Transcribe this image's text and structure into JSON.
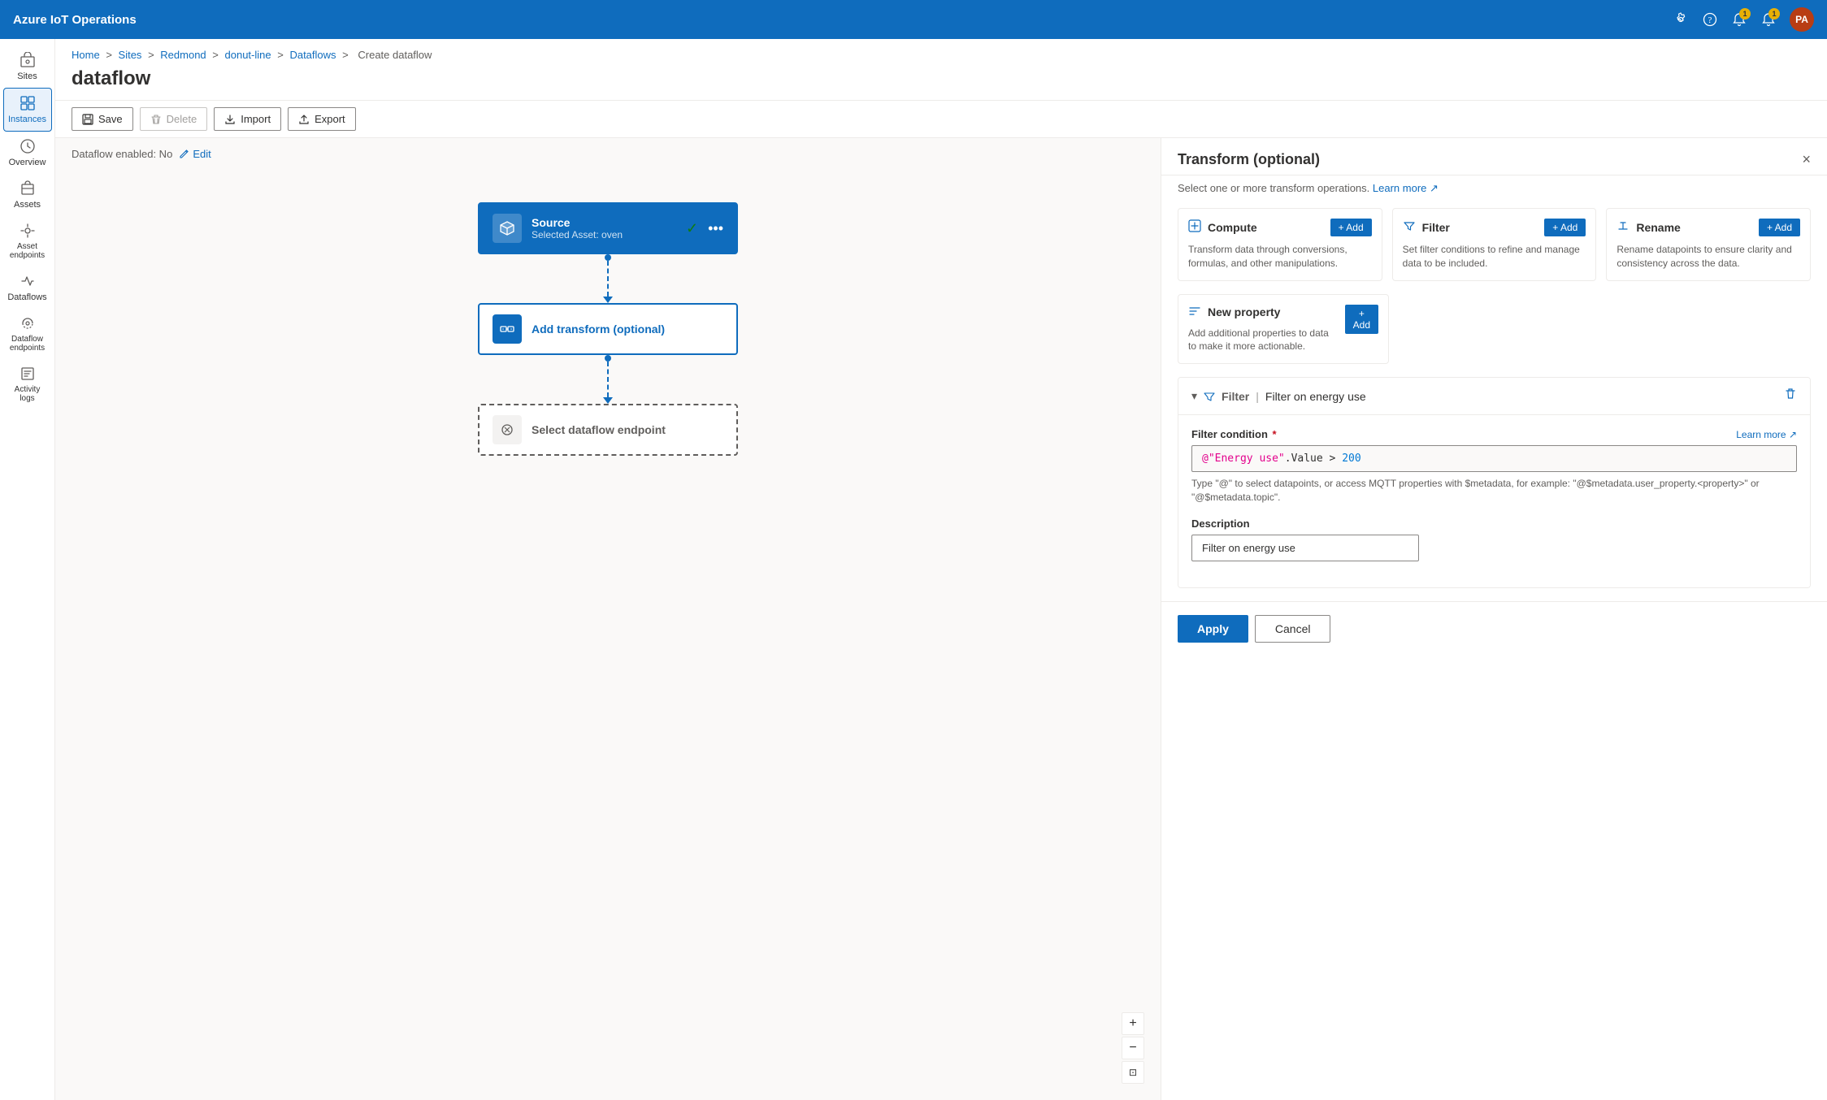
{
  "topbar": {
    "title": "Azure IoT Operations",
    "settings_icon": "⚙",
    "help_icon": "?",
    "notification_icon": "🔔",
    "alert_icon": "🔔",
    "notification_count": "1",
    "alert_count": "1",
    "avatar_initials": "PA"
  },
  "sidebar": {
    "items": [
      {
        "id": "sites",
        "label": "Sites",
        "icon": "sites"
      },
      {
        "id": "instances",
        "label": "Instances",
        "icon": "instances",
        "active": true
      },
      {
        "id": "overview",
        "label": "Overview",
        "icon": "overview"
      },
      {
        "id": "assets",
        "label": "Assets",
        "icon": "assets"
      },
      {
        "id": "asset-endpoints",
        "label": "Asset endpoints",
        "icon": "asset-endpoints"
      },
      {
        "id": "dataflows",
        "label": "Dataflows",
        "icon": "dataflows"
      },
      {
        "id": "dataflow-endpoints",
        "label": "Dataflow endpoints",
        "icon": "dataflow-endpoints"
      },
      {
        "id": "activity-logs",
        "label": "Activity logs",
        "icon": "activity-logs"
      }
    ]
  },
  "breadcrumb": {
    "items": [
      "Home",
      "Sites",
      "Redmond",
      "donut-line",
      "Dataflows",
      "Create dataflow"
    ]
  },
  "page": {
    "title": "dataflow"
  },
  "toolbar": {
    "save_label": "Save",
    "delete_label": "Delete",
    "import_label": "Import",
    "export_label": "Export"
  },
  "canvas": {
    "dataflow_status": "Dataflow enabled: No",
    "edit_label": "Edit",
    "nodes": [
      {
        "id": "source",
        "type": "source",
        "title": "Source",
        "subtitle": "Selected Asset: oven"
      },
      {
        "id": "transform",
        "type": "transform",
        "title": "Add transform (optional)"
      },
      {
        "id": "endpoint",
        "type": "endpoint",
        "title": "Select dataflow endpoint"
      }
    ],
    "zoom_plus": "+",
    "zoom_minus": "−",
    "zoom_fit": "⊡"
  },
  "panel": {
    "title": "Transform (optional)",
    "subtitle": "Select one or more transform operations.",
    "learn_more_label": "Learn more",
    "close_label": "×",
    "cards": [
      {
        "id": "compute",
        "title": "Compute",
        "add_label": "+ Add",
        "description": "Transform data through conversions, formulas, and other manipulations."
      },
      {
        "id": "filter",
        "title": "Filter",
        "add_label": "+ Add",
        "description": "Set filter conditions to refine and manage data to be included."
      },
      {
        "id": "rename",
        "title": "Rename",
        "add_label": "+ Add",
        "description": "Rename datapoints to ensure clarity and consistency across the data."
      }
    ],
    "new_property": {
      "title": "New property",
      "add_label": "+ Add",
      "description": "Add additional properties to data to make it more actionable."
    },
    "filter_section": {
      "label": "Filter",
      "name": "Filter on energy use",
      "condition_label": "Filter condition",
      "required_marker": "*",
      "learn_more_label": "Learn more",
      "condition_value": "@\"Energy use\".Value > 200",
      "hint": "Type \"@\" to select datapoints, or access MQTT properties with $metadata, for example: \"@$metadata.user_property.<property>\" or \"@$metadata.topic\".",
      "description_label": "Description",
      "description_value": "Filter on energy use"
    },
    "footer": {
      "apply_label": "Apply",
      "cancel_label": "Cancel"
    }
  }
}
